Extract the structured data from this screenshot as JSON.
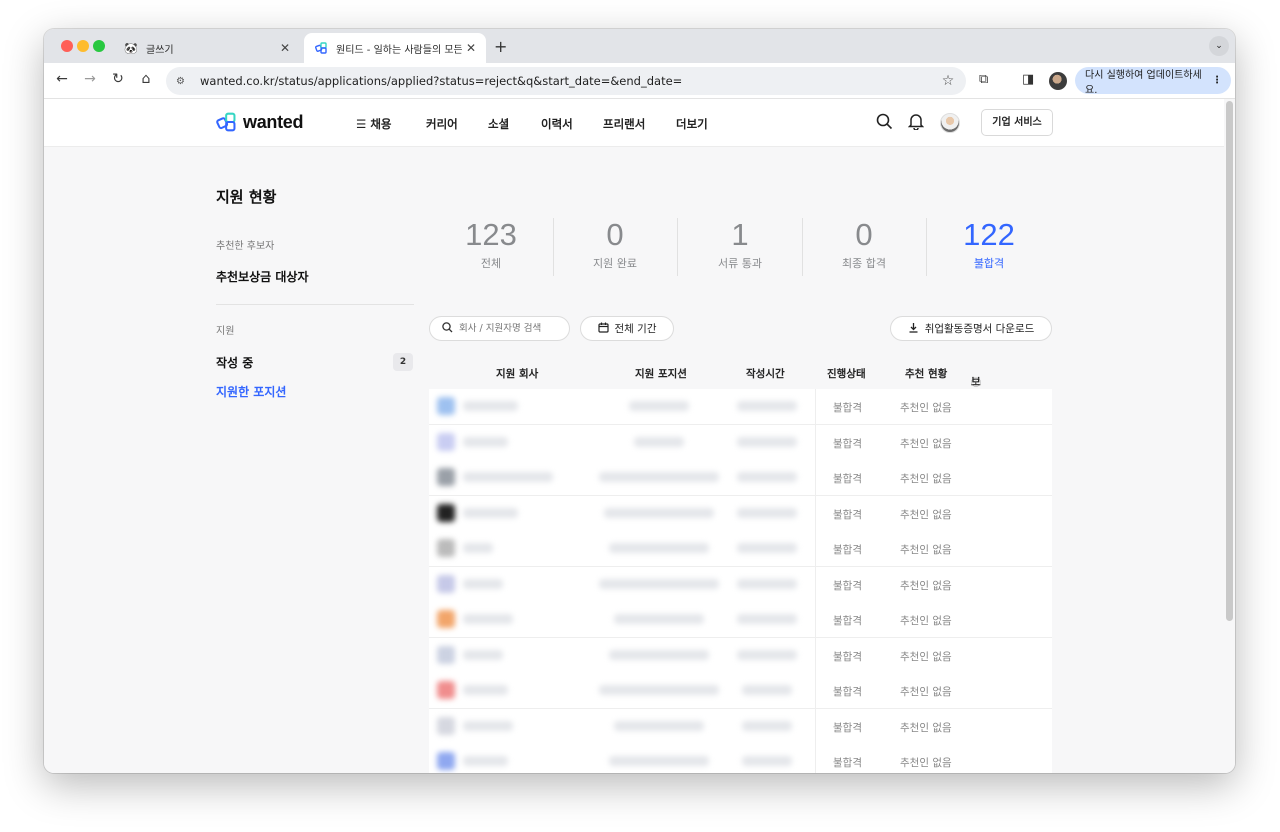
{
  "browser": {
    "tabs": [
      {
        "title": "글쓰기",
        "icon": "panda-icon"
      },
      {
        "title": "원티드 - 일하는 사람들의 모든 가능",
        "icon": "wanted-favicon"
      }
    ],
    "url": "wanted.co.kr/status/applications/applied?status=reject&q&start_date=&end_date=",
    "update_label": "다시 실행하여 업데이트하세요.",
    "colors": {
      "traffic_red": "#ff5f57",
      "traffic_yellow": "#febc2e",
      "traffic_green": "#28c840",
      "update_bg": "#d3e3fd"
    }
  },
  "gnb": {
    "logo_text": "wanted",
    "menu": [
      "채용",
      "커리어",
      "소셜",
      "이력서",
      "프리랜서",
      "더보기"
    ],
    "corp_service": "기업 서비스"
  },
  "sidebar": {
    "title": "지원 현황",
    "section1_label": "추천한 후보자",
    "section1_item": "추천보상금 대상자",
    "section2_label": "지원",
    "items": [
      {
        "label": "작성 중",
        "count": "2"
      },
      {
        "label": "지원한 포지션"
      }
    ]
  },
  "stats": [
    {
      "value": "123",
      "label": "전체"
    },
    {
      "value": "0",
      "label": "지원 완료"
    },
    {
      "value": "1",
      "label": "서류 통과"
    },
    {
      "value": "0",
      "label": "최종 합격"
    },
    {
      "value": "122",
      "label": "불합격"
    }
  ],
  "filters": {
    "search_placeholder": "회사 / 지원자명 검색",
    "period_label": "전체 기간",
    "download_label": "취업활동증명서 다운로드"
  },
  "table": {
    "headers": [
      "지원 회사",
      "지원 포지션",
      "작성시간",
      "진행상태",
      "추천 현황",
      "보상금 신청"
    ],
    "rows": [
      {
        "status": "불합격",
        "recommend": "추천인 없음"
      },
      {
        "status": "불합격",
        "recommend": "추천인 없음"
      },
      {
        "status": "불합격",
        "recommend": "추천인 없음"
      },
      {
        "status": "불합격",
        "recommend": "추천인 없음"
      },
      {
        "status": "불합격",
        "recommend": "추천인 없음"
      },
      {
        "status": "불합격",
        "recommend": "추천인 없음"
      },
      {
        "status": "불합격",
        "recommend": "추천인 없음"
      },
      {
        "status": "불합격",
        "recommend": "추천인 없음"
      },
      {
        "status": "불합격",
        "recommend": "추천인 없음"
      },
      {
        "status": "불합격",
        "recommend": "추천인 없음"
      },
      {
        "status": "불합격",
        "recommend": "추천인 없음"
      }
    ]
  },
  "accent_color": "#3366ff"
}
